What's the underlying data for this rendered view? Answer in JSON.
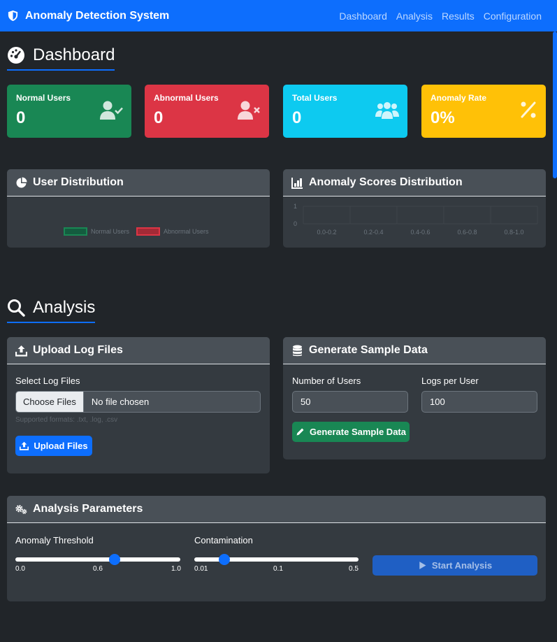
{
  "navbar": {
    "brand": "Anomaly Detection System",
    "links": [
      "Dashboard",
      "Analysis",
      "Results",
      "Configuration"
    ]
  },
  "dashboard": {
    "title": "Dashboard",
    "cards": [
      {
        "label": "Normal Users",
        "value": "0",
        "color": "#198754",
        "icon": "user-check-icon"
      },
      {
        "label": "Abnormal Users",
        "value": "0",
        "color": "#dc3545",
        "icon": "user-times-icon"
      },
      {
        "label": "Total Users",
        "value": "0",
        "color": "#0dcaf0",
        "icon": "users-icon"
      },
      {
        "label": "Anomaly Rate",
        "value": "0%",
        "color": "#ffc107",
        "icon": "percent-icon"
      }
    ],
    "user_distribution": {
      "title": "User Distribution",
      "legend": [
        "Normal Users",
        "Abnormal Users"
      ]
    },
    "scores_distribution": {
      "title": "Anomaly Scores Distribution",
      "y_ticks": [
        "1",
        "0"
      ],
      "categories": [
        "0.0-0.2",
        "0.2-0.4",
        "0.4-0.6",
        "0.6-0.8",
        "0.8-1.0"
      ]
    }
  },
  "chart_data": [
    {
      "type": "pie",
      "title": "User Distribution",
      "categories": [
        "Normal Users",
        "Abnormal Users"
      ],
      "values": [
        0,
        0
      ],
      "colors": [
        "#198754",
        "#dc3545"
      ],
      "legend": "top"
    },
    {
      "type": "bar",
      "title": "Anomaly Scores Distribution",
      "categories": [
        "0.0-0.2",
        "0.2-0.4",
        "0.4-0.6",
        "0.6-0.8",
        "0.8-1.0"
      ],
      "values": [
        0,
        0,
        0,
        0,
        0
      ],
      "ylim": [
        0,
        1
      ]
    }
  ],
  "analysis": {
    "title": "Analysis",
    "upload": {
      "title": "Upload Log Files",
      "label": "Select Log Files",
      "choose_button": "Choose Files",
      "file_status": "No file chosen",
      "hint": "Supported formats: .txt, .log, .csv",
      "upload_button": "Upload Files"
    },
    "sample": {
      "title": "Generate Sample Data",
      "users_label": "Number of Users",
      "users_value": "50",
      "logs_label": "Logs per User",
      "logs_value": "100",
      "generate_button": "Generate Sample Data"
    },
    "parameters": {
      "title": "Analysis Parameters",
      "threshold_label": "Anomaly Threshold",
      "threshold_value": 0.6,
      "threshold_ticks": [
        "0.0",
        "0.6",
        "1.0"
      ],
      "contamination_label": "Contamination",
      "contamination_value": 0.1,
      "contamination_ticks": [
        "0.01",
        "0.1",
        "0.5"
      ],
      "start_button": "Start Analysis"
    }
  }
}
